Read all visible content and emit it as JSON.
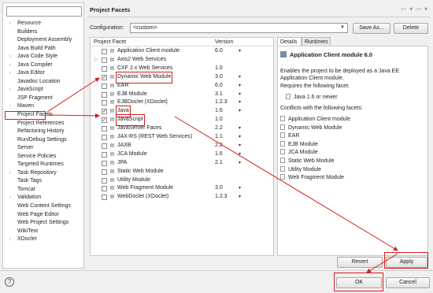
{
  "left_nav": {
    "filter_placeholder": "",
    "items": [
      {
        "label": "Resource",
        "expandable": true
      },
      {
        "label": "Builders",
        "expandable": false
      },
      {
        "label": "Deployment Assembly",
        "expandable": false
      },
      {
        "label": "Java Build Path",
        "expandable": false
      },
      {
        "label": "Java Code Style",
        "expandable": true
      },
      {
        "label": "Java Compiler",
        "expandable": true
      },
      {
        "label": "Java Editor",
        "expandable": true
      },
      {
        "label": "Javadoc Location",
        "expandable": false
      },
      {
        "label": "JavaScript",
        "expandable": true
      },
      {
        "label": "JSP Fragment",
        "expandable": false
      },
      {
        "label": "Maven",
        "expandable": true
      },
      {
        "label": "Project Facets",
        "expandable": false,
        "selected": true
      },
      {
        "label": "Project References",
        "expandable": false
      },
      {
        "label": "Refactoring History",
        "expandable": false
      },
      {
        "label": "Run/Debug Settings",
        "expandable": false
      },
      {
        "label": "Server",
        "expandable": false
      },
      {
        "label": "Service Policies",
        "expandable": false
      },
      {
        "label": "Targeted Runtimes",
        "expandable": false
      },
      {
        "label": "Task Repository",
        "expandable": true
      },
      {
        "label": "Task Tags",
        "expandable": false
      },
      {
        "label": "Tomcat",
        "expandable": false
      },
      {
        "label": "Validation",
        "expandable": true
      },
      {
        "label": "Web Content Settings",
        "expandable": false
      },
      {
        "label": "Web Page Editor",
        "expandable": false
      },
      {
        "label": "Web Project Settings",
        "expandable": false
      },
      {
        "label": "WikiText",
        "expandable": false
      },
      {
        "label": "XDoclet",
        "expandable": true
      }
    ]
  },
  "header": {
    "title": "Project Facets",
    "nav_icons": [
      "back-arrow-icon",
      "forward-arrow-icon",
      "menu-arrow-icon"
    ]
  },
  "config": {
    "label": "Configuration:",
    "value": "<custom>",
    "save_as_label": "Save As...",
    "delete_label": "Delete"
  },
  "facets": {
    "col_facet": "Project Facet",
    "col_version": "Version",
    "rows": [
      {
        "name": "Application Client module",
        "version": "6.0",
        "checked": false,
        "expandable": false,
        "has_dropdown": true,
        "highlight": false
      },
      {
        "name": "Axis2 Web Services",
        "version": "",
        "checked": false,
        "expandable": true,
        "has_dropdown": false,
        "highlight": false
      },
      {
        "name": "CXF 2.x Web Services",
        "version": "1.0",
        "checked": false,
        "expandable": false,
        "has_dropdown": false,
        "highlight": false
      },
      {
        "name": "Dynamic Web Module",
        "version": "3.0",
        "checked": true,
        "expandable": false,
        "has_dropdown": true,
        "highlight": true
      },
      {
        "name": "EAR",
        "version": "6.0",
        "checked": false,
        "expandable": false,
        "has_dropdown": true,
        "highlight": false
      },
      {
        "name": "EJB Module",
        "version": "3.1",
        "checked": false,
        "expandable": false,
        "has_dropdown": true,
        "highlight": false
      },
      {
        "name": "EJBDoclet (XDoclet)",
        "version": "1.2.3",
        "checked": false,
        "expandable": false,
        "has_dropdown": true,
        "highlight": false
      },
      {
        "name": "Java",
        "version": "1.6",
        "checked": true,
        "expandable": false,
        "has_dropdown": true,
        "highlight": true
      },
      {
        "name": "JavaScript",
        "version": "1.0",
        "checked": true,
        "expandable": false,
        "has_dropdown": false,
        "highlight": true
      },
      {
        "name": "JavaServer Faces",
        "version": "2.2",
        "checked": false,
        "expandable": false,
        "has_dropdown": true,
        "highlight": false
      },
      {
        "name": "JAX-RS (REST Web Services)",
        "version": "1.1",
        "checked": false,
        "expandable": false,
        "has_dropdown": true,
        "highlight": false
      },
      {
        "name": "JAXB",
        "version": "2.2",
        "checked": false,
        "expandable": false,
        "has_dropdown": true,
        "highlight": false
      },
      {
        "name": "JCA Module",
        "version": "1.6",
        "checked": false,
        "expandable": false,
        "has_dropdown": true,
        "highlight": false
      },
      {
        "name": "JPA",
        "version": "2.1",
        "checked": false,
        "expandable": false,
        "has_dropdown": true,
        "highlight": false
      },
      {
        "name": "Static Web Module",
        "version": "",
        "checked": false,
        "expandable": false,
        "has_dropdown": false,
        "highlight": false
      },
      {
        "name": "Utility Module",
        "version": "",
        "checked": false,
        "expandable": false,
        "has_dropdown": false,
        "highlight": false
      },
      {
        "name": "Web Fragment Module",
        "version": "3.0",
        "checked": false,
        "expandable": false,
        "has_dropdown": true,
        "highlight": false
      },
      {
        "name": "WebDoclet (XDoclet)",
        "version": "1.2.3",
        "checked": false,
        "expandable": false,
        "has_dropdown": true,
        "highlight": false
      }
    ]
  },
  "details": {
    "tab_details": "Details",
    "tab_runtimes": "Runtimes",
    "title": "Application Client module 6.0",
    "description": "Enables the project to be deployed as a Java EE Application Client module.",
    "requires_label": "Requires the following facet:",
    "requires_item": "Java 1.6 or newer",
    "conflicts_label": "Conflicts with the following facets:",
    "conflicts": [
      "Application Client module",
      "Dynamic Web Module",
      "EAR",
      "EJB Module",
      "JCA Module",
      "Static Web Module",
      "Utility Module",
      "Web Fragment Module"
    ]
  },
  "buttons": {
    "revert": "Revert",
    "apply": "Apply",
    "ok": "OK",
    "cancel": "Cancel",
    "help": "?"
  },
  "colors": {
    "highlight": "#d21e1e"
  }
}
